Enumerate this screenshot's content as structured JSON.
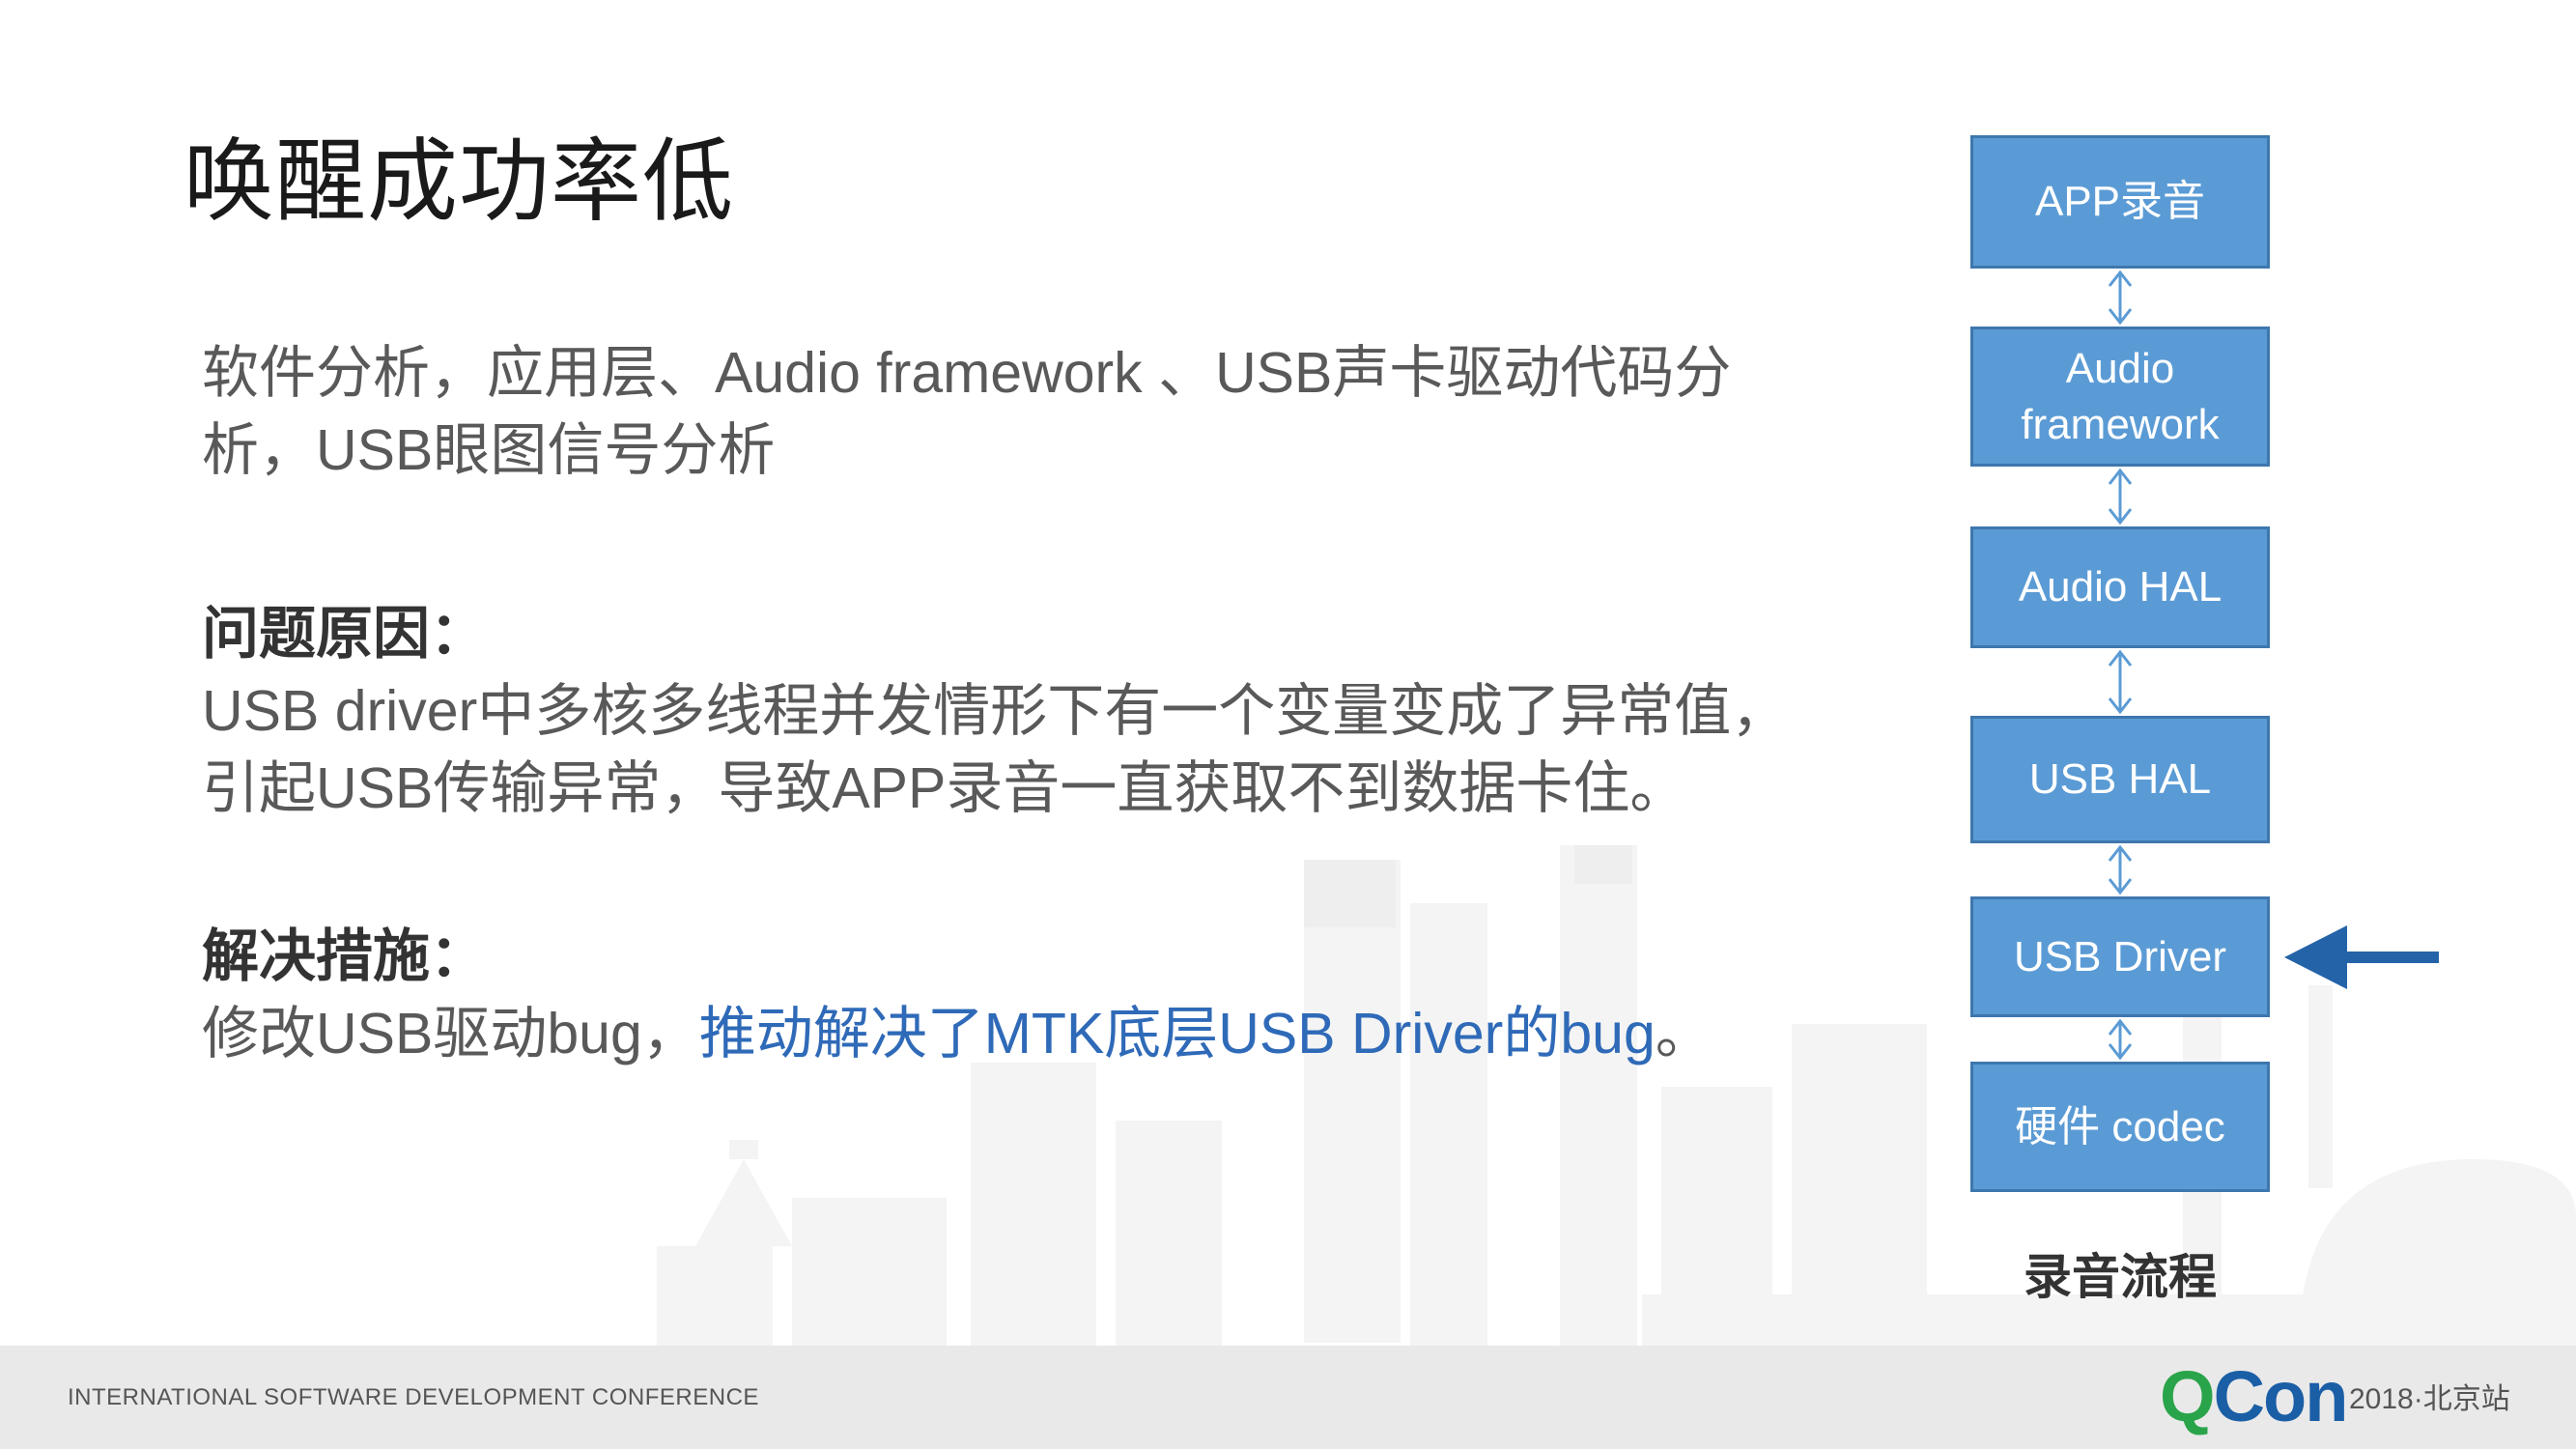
{
  "slide": {
    "title": "唤醒成功率低",
    "analysis": "软件分析，应用层、Audio framework 、USB声卡驱动代码分析，USB眼图信号分析",
    "cause_heading": "问题原因：",
    "cause_text": "USB driver中多核多线程并发情形下有一个变量变成了异常值，引起USB传输异常，导致APP录音一直获取不到数据卡住。",
    "solution_heading": "解决措施：",
    "solution_text": "修改USB驱动bug，",
    "solution_highlight": "推动解决了MTK底层USB Driver的bug",
    "solution_end": "。"
  },
  "flow": {
    "boxes": [
      "APP录音",
      "Audio framework",
      "Audio HAL",
      "USB HAL",
      "USB Driver",
      "硬件 codec"
    ],
    "label": "录音流程",
    "pointer": "USB Driver"
  },
  "footer": {
    "conference": "INTERNATIONAL SOFTWARE DEVELOPMENT CONFERENCE",
    "logo_q": "Q",
    "logo_rest": "Con",
    "edition": "2018·北京站"
  },
  "colors": {
    "box_fill": "#5b9bd5",
    "box_border": "#3e77ae",
    "highlight": "#2f6ab8",
    "pointer_arrow": "#2563a8"
  }
}
